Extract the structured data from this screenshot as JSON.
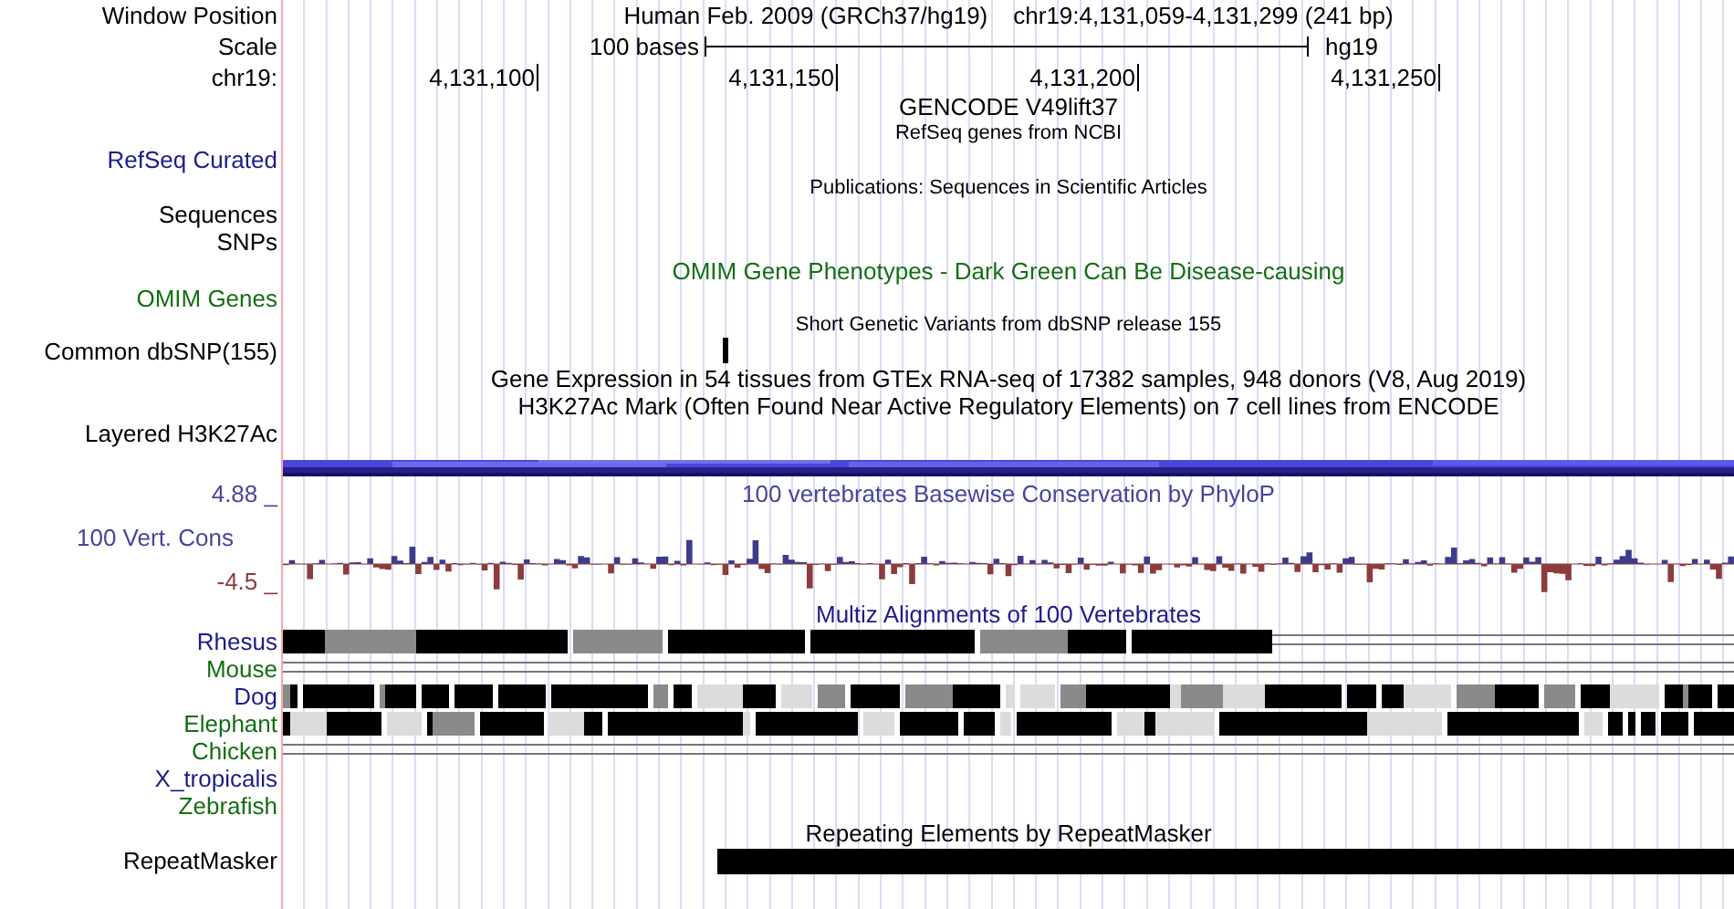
{
  "window_position": {
    "label": "Window Position",
    "assembly": "Human Feb. 2009 (GRCh37/hg19)",
    "position": "chr19:4,131,059-4,131,299 (241 bp)"
  },
  "scale": {
    "label": "Scale",
    "length": "100 bases",
    "assembly": "hg19"
  },
  "ruler": {
    "label": "chr19:",
    "ticks": [
      "4,131,100",
      "4,131,150",
      "4,131,200",
      "4,131,250"
    ]
  },
  "tracks": [
    {
      "kind": "title",
      "text": "GENCODE V49lift37",
      "color": "#000000"
    },
    {
      "kind": "note",
      "text": "RefSeq genes from NCBI",
      "color": "#000000"
    },
    {
      "kind": "label",
      "label": "RefSeq Curated",
      "color": "#1c1c8c"
    },
    {
      "kind": "note",
      "text": "Publications: Sequences in Scientific Articles",
      "color": "#000000"
    },
    {
      "kind": "label",
      "label": "Sequences",
      "color": "#000000"
    },
    {
      "kind": "label",
      "label": "SNPs",
      "color": "#000000"
    },
    {
      "kind": "title",
      "text": "OMIM Gene Phenotypes - Dark Green Can Be Disease-causing",
      "color": "#146e14"
    },
    {
      "kind": "label",
      "label": "OMIM Genes",
      "color": "#146e14"
    },
    {
      "kind": "note",
      "text": "Short Genetic Variants from dbSNP release 155",
      "color": "#000000"
    },
    {
      "kind": "variant",
      "label": "Common dbSNP(155)",
      "color": "#000000"
    },
    {
      "kind": "title",
      "text": "Gene Expression in 54 tissues from GTEx RNA-seq of 17382 samples, 948 donors (V8, Aug 2019)",
      "color": "#000000"
    },
    {
      "kind": "title",
      "text": "H3K27Ac Mark (Often Found Near Active Regulatory Elements) on 7 cell lines from ENCODE",
      "color": "#000000"
    },
    {
      "kind": "label",
      "label": "Layered H3K27Ac",
      "color": "#000000"
    },
    {
      "kind": "band"
    },
    {
      "kind": "wiggle",
      "label": "100 Vert. Cons",
      "title": "100 vertebrates Basewise Conservation by PhyloP",
      "max": "4.88 _",
      "min": "-4.5 _",
      "color": "#46469a"
    },
    {
      "kind": "title",
      "text": "Multiz Alignments of 100 Vertebrates",
      "color": "#1c1c8c"
    },
    {
      "kind": "partial",
      "label": "Rhesus",
      "color": "#1c1c8c"
    },
    {
      "kind": "lines",
      "label": "Mouse",
      "color": "#146e14"
    },
    {
      "kind": "blocks",
      "label": "Dog",
      "color": "#1c1c8c"
    },
    {
      "kind": "blocks",
      "label": "Elephant",
      "color": "#146e14"
    },
    {
      "kind": "lines",
      "label": "Chicken",
      "color": "#146e14"
    },
    {
      "kind": "empty",
      "label": "X_tropicalis",
      "color": "#1c1c8c"
    },
    {
      "kind": "empty",
      "label": "Zebrafish",
      "color": "#146e14"
    },
    {
      "kind": "title",
      "text": "Repeating Elements by RepeatMasker",
      "color": "#000000"
    },
    {
      "kind": "repeat",
      "label": "RepeatMasker",
      "color": "#000000"
    }
  ]
}
